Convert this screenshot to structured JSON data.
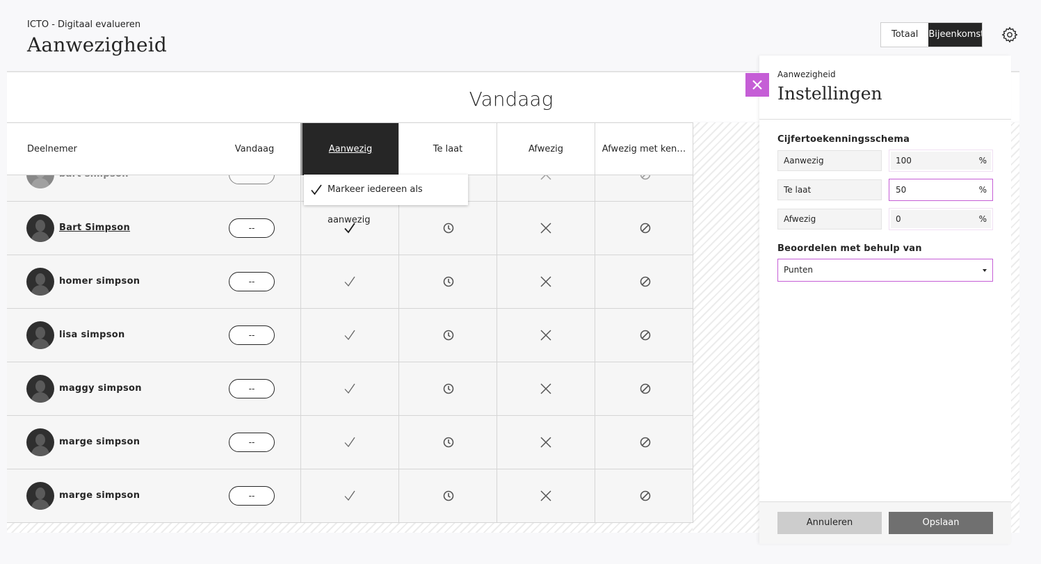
{
  "header": {
    "course": "ICTO - Digitaal evalueren",
    "title": "Aanwezigheid",
    "view_toggle": {
      "total": "Totaal",
      "meeting": "Bijeenkomst"
    }
  },
  "main": {
    "day_title": "Vandaag",
    "columns": {
      "participant": "Deelnemer",
      "today": "Vandaag",
      "present": "Aanwezig",
      "late": "Te laat",
      "absent": "Afwezig",
      "excused": "Afwezig met ken…"
    },
    "bulk_menu": {
      "mark_all": "Markeer iedereen als aanwezig"
    },
    "rows": [
      {
        "name": "bart simpson",
        "status": "--"
      },
      {
        "name": "Bart Simpson",
        "status": "--"
      },
      {
        "name": "homer simpson",
        "status": "--"
      },
      {
        "name": "lisa simpson",
        "status": "--"
      },
      {
        "name": "maggy simpson",
        "status": "--"
      },
      {
        "name": "marge simpson",
        "status": "--"
      },
      {
        "name": "marge simpson",
        "status": "--"
      }
    ]
  },
  "settings_panel": {
    "pre_title": "Aanwezigheid",
    "title": "Instellingen",
    "schema_label": "Cijfertoekenningsschema",
    "schema": [
      {
        "label": "Aanwezig",
        "value": "100",
        "unit": "%"
      },
      {
        "label": "Te laat",
        "value": "50",
        "unit": "%"
      },
      {
        "label": "Afwezig",
        "value": "0",
        "unit": "%"
      }
    ],
    "grade_label": "Beoordelen met behulp van",
    "grade_value": "Punten",
    "cancel": "Annuleren",
    "save": "Opslaan"
  },
  "colors": {
    "accent": "#c55ed6",
    "dark": "#262626"
  }
}
